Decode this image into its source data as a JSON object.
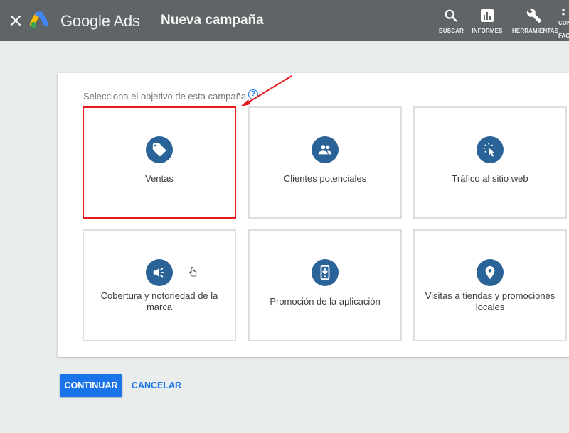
{
  "header": {
    "brand": "Google Ads",
    "page_title": "Nueva campaña",
    "tools": [
      {
        "label": "BUSCAR",
        "icon": "search-icon"
      },
      {
        "label": "INFORMES",
        "icon": "bar-chart-icon"
      },
      {
        "label": "HERRAMIENTAS",
        "icon": "wrench-icon"
      },
      {
        "label_line1": "CON",
        "label_line2": "FACT",
        "icon": "more-vert-icon"
      }
    ]
  },
  "main": {
    "prompt": "Selecciona el objetivo de esta campaña",
    "help_symbol": "?",
    "objectives": [
      {
        "label": "Ventas",
        "icon": "tag-icon",
        "selected": true
      },
      {
        "label": "Clientes potenciales",
        "icon": "people-icon",
        "selected": false
      },
      {
        "label": "Tráfico al sitio web",
        "icon": "cursor-click-icon",
        "selected": false
      },
      {
        "label": "Cobertura y notoriedad de la marca",
        "icon": "megaphone-icon",
        "selected": false
      },
      {
        "label": "Promoción de la aplicación",
        "icon": "phone-download-icon",
        "selected": false
      },
      {
        "label": "Visitas a tiendas y promociones locales",
        "icon": "location-pin-icon",
        "selected": false
      }
    ]
  },
  "actions": {
    "continue_label": "CONTINUAR",
    "cancel_label": "CANCELAR"
  },
  "colors": {
    "accent": "#1a73e8",
    "icon_circle": "#2a6398",
    "header_bg": "#5f6466",
    "highlight": "#e8191b"
  }
}
